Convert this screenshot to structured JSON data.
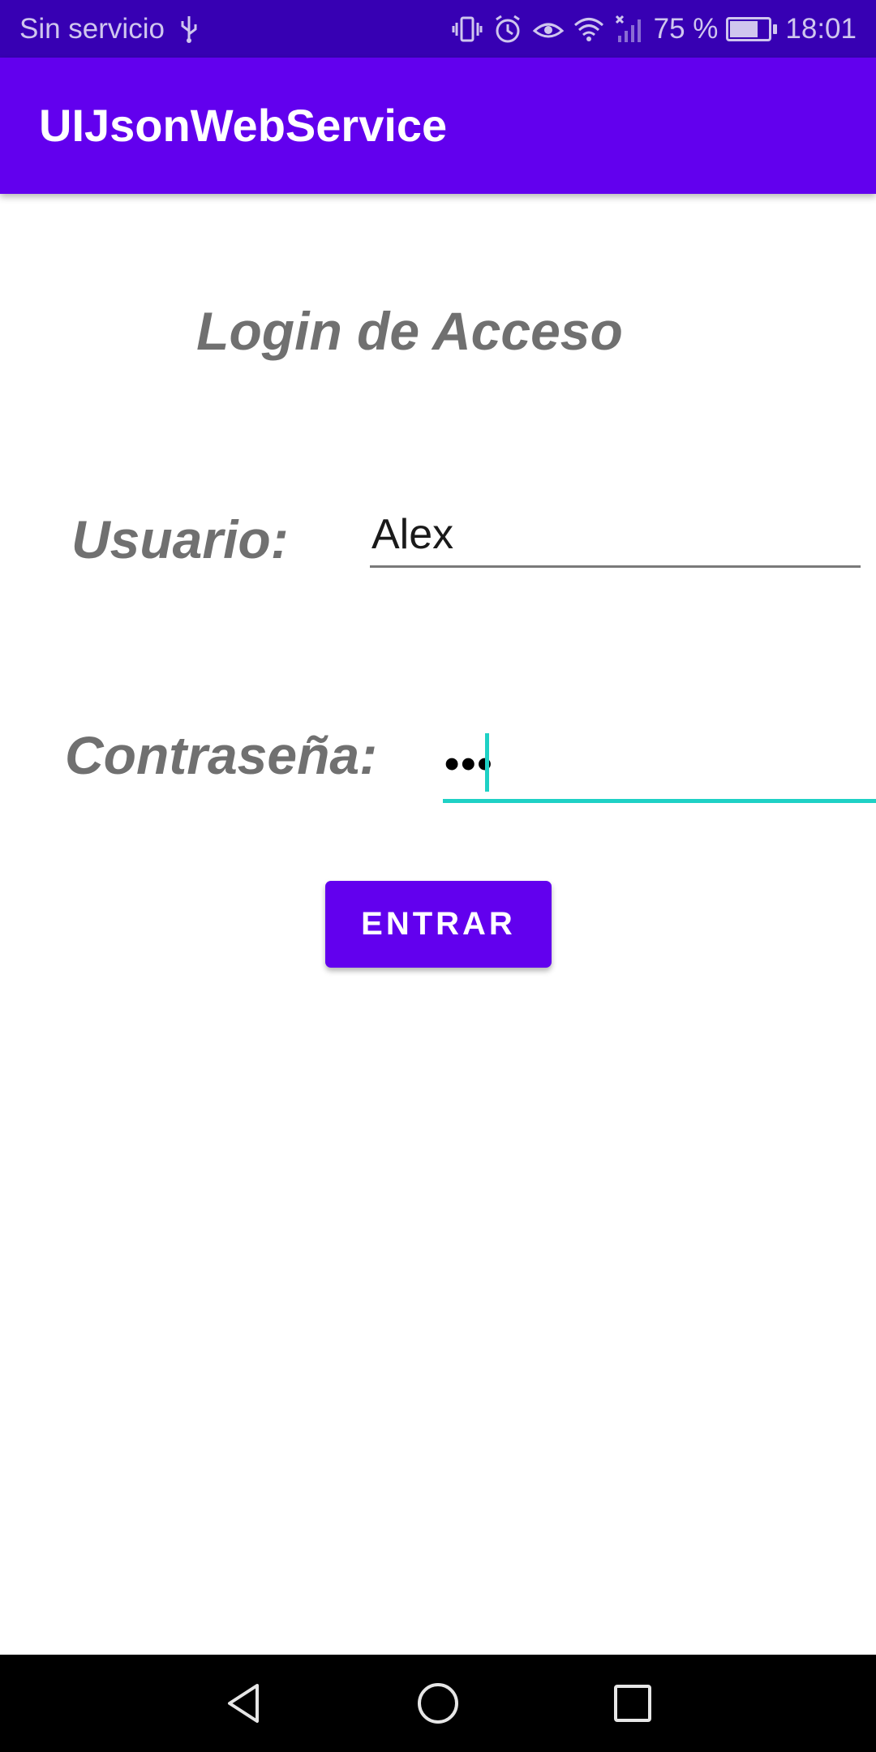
{
  "status_bar": {
    "carrier": "Sin servicio",
    "battery_percent": "75 %",
    "battery_level": 0.75,
    "time": "18:01",
    "icons": [
      "usb-icon",
      "vibrate-icon",
      "alarm-icon",
      "eye-comfort-icon",
      "wifi-icon",
      "no-signal-icon",
      "battery-icon"
    ]
  },
  "app_bar": {
    "title": "UIJsonWebService"
  },
  "login": {
    "heading": "Login de Acceso",
    "user_label": "Usuario:",
    "user_value": "Alex",
    "password_label": "Contraseña:",
    "password_mask": "•••",
    "submit_label": "ENTRAR"
  },
  "nav_bar": {
    "buttons": [
      "back-icon",
      "home-icon",
      "recents-icon"
    ]
  },
  "colors": {
    "status_bar": "#3700b3",
    "primary": "#6200ee",
    "accent": "#1fd1c5",
    "label_gray": "#707070"
  }
}
